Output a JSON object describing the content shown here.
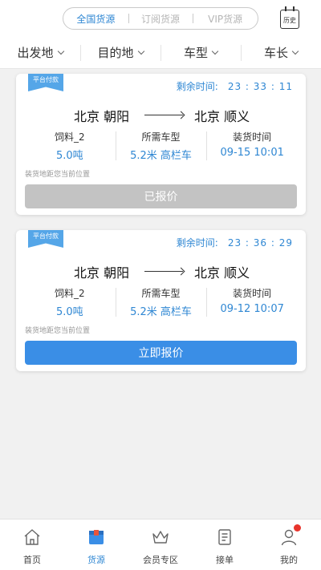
{
  "top_segments": [
    "全国货源",
    "订阅货源",
    "VIP货源"
  ],
  "history_label": "历史",
  "filters": [
    "出发地",
    "目的地",
    "车型",
    "车长"
  ],
  "cards": [
    {
      "tag": "平台付款",
      "timer_label": "剩余时间:",
      "timer_value": "23 : 33 : 11",
      "from": "北京 朝阳",
      "to": "北京 顺义",
      "goods_name": "饲料_2",
      "goods_weight": "5.0吨",
      "vehicle_label": "所需车型",
      "vehicle_value": "5.2米 高栏车",
      "load_label": "装货时间",
      "load_time": "09-15 10:01",
      "distance_text": "装货地距您当前位置",
      "button": "已报价"
    },
    {
      "tag": "平台付款",
      "timer_label": "剩余时间:",
      "timer_value": "23 : 36 : 29",
      "from": "北京 朝阳",
      "to": "北京 顺义",
      "goods_name": "饲料_2",
      "goods_weight": "5.0吨",
      "vehicle_label": "所需车型",
      "vehicle_value": "5.2米 高栏车",
      "load_label": "装货时间",
      "load_time": "09-12 10:07",
      "distance_text": "装货地距您当前位置",
      "button": "立即报价"
    }
  ],
  "tabs": [
    {
      "label": "首页",
      "icon": "home-icon"
    },
    {
      "label": "货源",
      "icon": "cargo-box-icon"
    },
    {
      "label": "会员专区",
      "icon": "crown-icon"
    },
    {
      "label": "接单",
      "icon": "order-list-icon"
    },
    {
      "label": "我的",
      "icon": "user-icon"
    }
  ],
  "colors": {
    "accent": "#2f87d3",
    "button_active": "#3a8ee6",
    "button_disabled": "#c3c3c3",
    "badge": "#e8342c"
  }
}
